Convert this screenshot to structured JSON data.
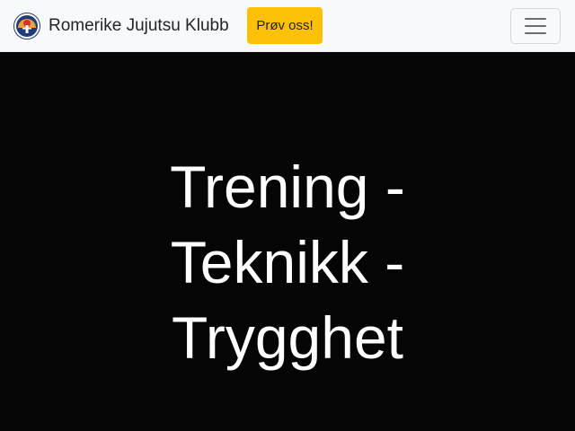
{
  "navbar": {
    "brand_name": "Romerike Jujutsu Klubb",
    "logo_icon": "club-logo-icon",
    "cta_label": "Prøv oss!",
    "menu_icon": "hamburger-menu-icon",
    "colors": {
      "background": "#f8f9fa",
      "cta": "#ffc107"
    }
  },
  "hero": {
    "lines": [
      "Trening -",
      "Teknikk -",
      "Trygghet"
    ],
    "colors": {
      "background": "#050505",
      "text": "#ffffff"
    }
  }
}
